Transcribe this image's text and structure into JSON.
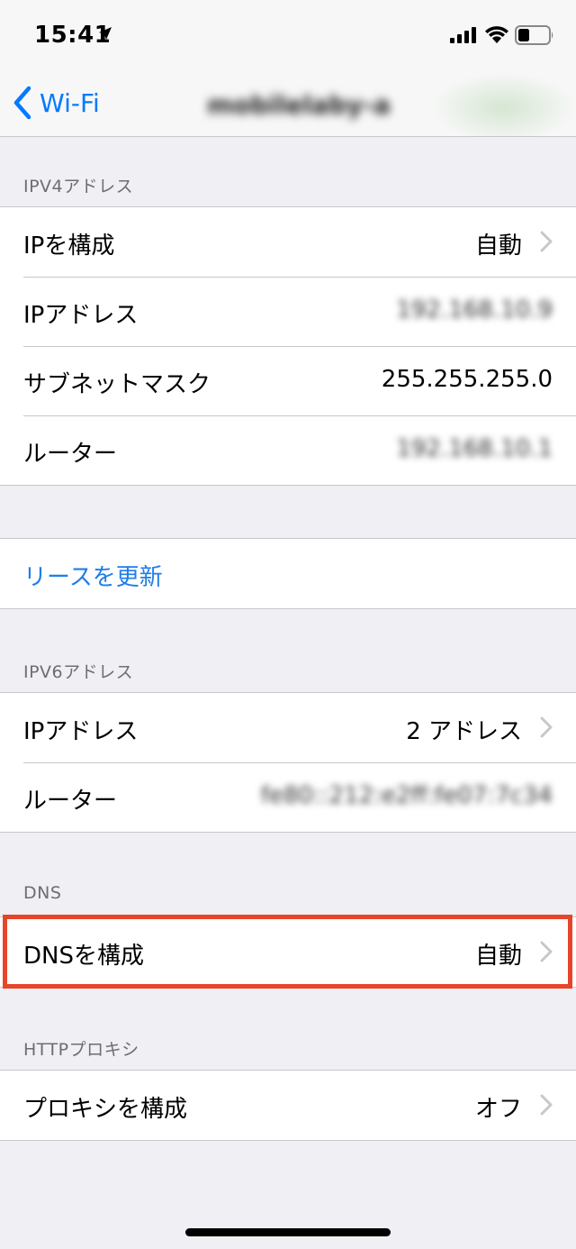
{
  "status_bar": {
    "time": "15:41"
  },
  "nav": {
    "back_label": "Wi-Fi",
    "title": "mobilelaby-a"
  },
  "ipv4": {
    "header": "IPV4アドレス",
    "rows": [
      {
        "label": "IPを構成",
        "value": "自動"
      },
      {
        "label": "IPアドレス",
        "value": "192.168.10.9"
      },
      {
        "label": "サブネットマスク",
        "value": "255.255.255.0"
      },
      {
        "label": "ルーター",
        "value": "192.168.10.1"
      }
    ]
  },
  "renew": {
    "label": "リースを更新"
  },
  "ipv6": {
    "header": "IPV6アドレス",
    "rows": [
      {
        "label": "IPアドレス",
        "value": "2 アドレス"
      },
      {
        "label": "ルーター",
        "value": "fe80::212:e2ff:fe07:7c34"
      }
    ]
  },
  "dns": {
    "header": "DNS",
    "row": {
      "label": "DNSを構成",
      "value": "自動"
    }
  },
  "proxy": {
    "header": "HTTPプロキシ",
    "row": {
      "label": "プロキシを構成",
      "value": "オフ"
    }
  },
  "colors": {
    "accent": "#007aff",
    "link": "#1f7de9",
    "highlight": "#e8442a",
    "background": "#efeff4"
  }
}
